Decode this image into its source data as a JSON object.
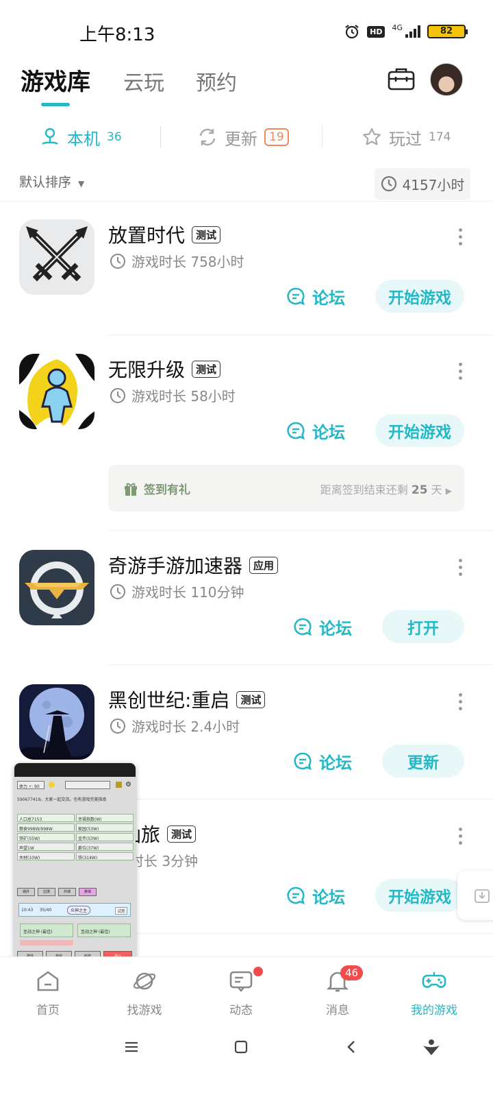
{
  "status": {
    "time": "上午8:13",
    "hd": "HD",
    "network": "4G",
    "battery": "82"
  },
  "top_tabs": [
    {
      "label": "游戏库",
      "active": true
    },
    {
      "label": "云玩",
      "active": false
    },
    {
      "label": "预约",
      "active": false
    }
  ],
  "sub_tabs": {
    "local": {
      "label": "本机",
      "count": "36"
    },
    "update": {
      "label": "更新",
      "count": "19"
    },
    "played": {
      "label": "玩过",
      "count": "174"
    }
  },
  "sort": {
    "label": "默认排序",
    "total_playtime": "4157小时"
  },
  "games": [
    {
      "title": "放置时代",
      "tag": "测试",
      "time": "游戏时长 758小时",
      "forum": "论坛",
      "action": "开始游戏",
      "icon": "crossed-swords-icon"
    },
    {
      "title": "无限升级",
      "tag": "测试",
      "time": "游戏时长 58小时",
      "forum": "论坛",
      "action": "开始游戏",
      "icon": "stickman-icon"
    },
    {
      "title": "奇游手游加速器",
      "tag": "应用",
      "time": "游戏时长 110分钟",
      "forum": "论坛",
      "action": "打开",
      "icon": "accelerator-icon"
    },
    {
      "title": "黑创世纪:重启",
      "tag": "测试",
      "time": "游戏时长 2.4小时",
      "forum": "论坛",
      "action": "更新",
      "icon": "moon-swordsman-icon"
    },
    {
      "title": "元仙旅",
      "tag": "测试",
      "time": "游戏时长 3分钟",
      "forum": "论坛",
      "action": "开始游戏",
      "icon": "partially-hidden-icon"
    }
  ],
  "signin": {
    "label": "签到有礼",
    "prefix": "距离签到结束还剩",
    "days": "25",
    "suffix": "天"
  },
  "float_window": {
    "stamina": "体力 ⚡: 90",
    "chat": "590677419。大家一起交流。也有游戏完美指南",
    "stats": [
      "人口总7153",
      "幸福指数(W)",
      "粮食998W/998W",
      "家园(53W)",
      "铁矿(55W)",
      "金币(53W)",
      "声望1W",
      "爵位(37W)",
      "木材(10W)",
      "铁(314W)"
    ],
    "tabs": [
      "城外",
      "边境",
      "外城",
      "禁城"
    ],
    "timer": "10:43",
    "progress": "35/40",
    "boss": "众神之主",
    "challenge": "试炼",
    "slots": [
      "圣战之神 (最佳)",
      "圣战之神 (最佳)"
    ],
    "bottom": [
      "建造",
      "商店",
      "科技",
      "战斗"
    ]
  },
  "bottom_nav": [
    {
      "label": "首页",
      "active": false
    },
    {
      "label": "找游戏",
      "active": false
    },
    {
      "label": "动态",
      "active": false
    },
    {
      "label": "消息",
      "active": false,
      "badge": "46"
    },
    {
      "label": "我的游戏",
      "active": true
    }
  ],
  "colors": {
    "accent": "#22b8c6",
    "update_badge": "#ef8a57",
    "alert": "#f24b4b",
    "signin_green": "#7d9a73"
  }
}
